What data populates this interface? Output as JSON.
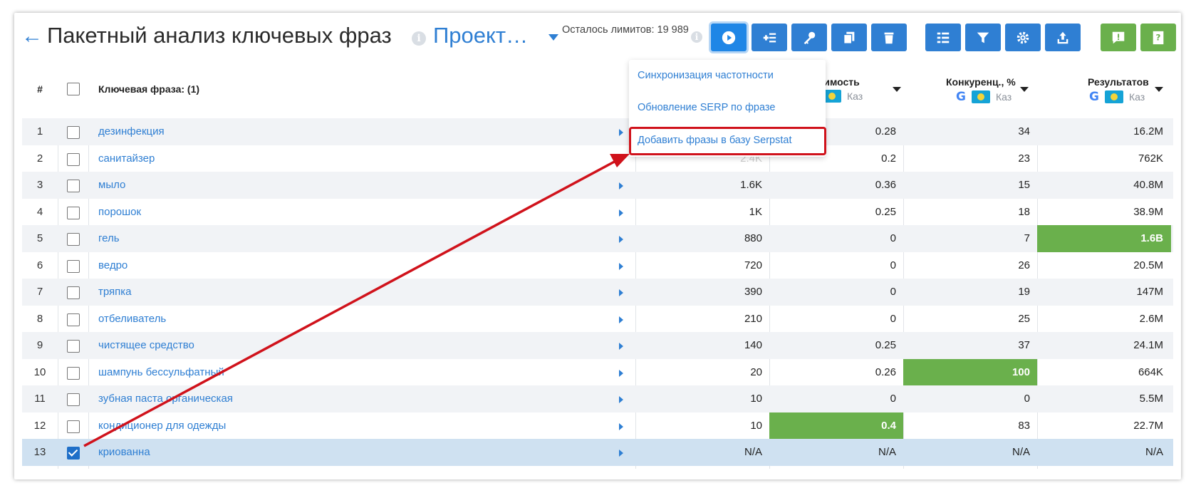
{
  "header": {
    "title": "Пакетный анализ ключевых фраз",
    "project": "Проект…",
    "limits": "Осталось лимитов: 19 989"
  },
  "toolbar": {
    "buttons": [
      "play-icon",
      "add-list-icon",
      "key-icon",
      "copy-icon",
      "trash-icon",
      "columns-icon",
      "filter-icon",
      "gear-icon",
      "export-icon",
      "alert-icon",
      "help-icon"
    ]
  },
  "table": {
    "headers": {
      "num": "#",
      "phrase": "Ключевая фраза: (1)",
      "cost": "Стоимость",
      "competition": "Конкуренц., %",
      "results": "Результатов",
      "region": "Каз"
    },
    "rows": [
      {
        "num": "1",
        "phrase": "дезинфекция",
        "vol": "",
        "cost": "0.28",
        "comp": "34",
        "res": "16.2M"
      },
      {
        "num": "2",
        "phrase": "санитайзер",
        "vol": "2.4K",
        "cost": "0.2",
        "comp": "23",
        "res": "762K"
      },
      {
        "num": "3",
        "phrase": "мыло",
        "vol": "1.6K",
        "cost": "0.36",
        "comp": "15",
        "res": "40.8M"
      },
      {
        "num": "4",
        "phrase": "порошок",
        "vol": "1K",
        "cost": "0.25",
        "comp": "18",
        "res": "38.9M"
      },
      {
        "num": "5",
        "phrase": "гель",
        "vol": "880",
        "cost": "0",
        "comp": "7",
        "res": "1.6B"
      },
      {
        "num": "6",
        "phrase": "ведро",
        "vol": "720",
        "cost": "0",
        "comp": "26",
        "res": "20.5M"
      },
      {
        "num": "7",
        "phrase": "тряпка",
        "vol": "390",
        "cost": "0",
        "comp": "19",
        "res": "147M"
      },
      {
        "num": "8",
        "phrase": "отбеливатель",
        "vol": "210",
        "cost": "0",
        "comp": "25",
        "res": "2.6M"
      },
      {
        "num": "9",
        "phrase": "чистящее средство",
        "vol": "140",
        "cost": "0.25",
        "comp": "37",
        "res": "24.1M"
      },
      {
        "num": "10",
        "phrase": "шампунь бессульфатный",
        "vol": "20",
        "cost": "0.26",
        "comp": "100",
        "res": "664K"
      },
      {
        "num": "11",
        "phrase": "зубная паста органическая",
        "vol": "10",
        "cost": "0",
        "comp": "0",
        "res": "5.5M"
      },
      {
        "num": "12",
        "phrase": "кондиционер для одежды",
        "vol": "10",
        "cost": "0.4",
        "comp": "83",
        "res": "22.7M"
      },
      {
        "num": "13",
        "phrase": "криованна",
        "vol": "N/A",
        "cost": "N/A",
        "comp": "N/A",
        "res": "N/A"
      }
    ]
  },
  "dropdown": {
    "items": [
      "Синхронизация частотности",
      "Обновление SERP по фразе",
      "Добавить фразы в базу Serpstat"
    ]
  },
  "colors": {
    "accent": "#2f7fd3",
    "highlight": "#6ab04c",
    "annotation": "#d0121b"
  }
}
